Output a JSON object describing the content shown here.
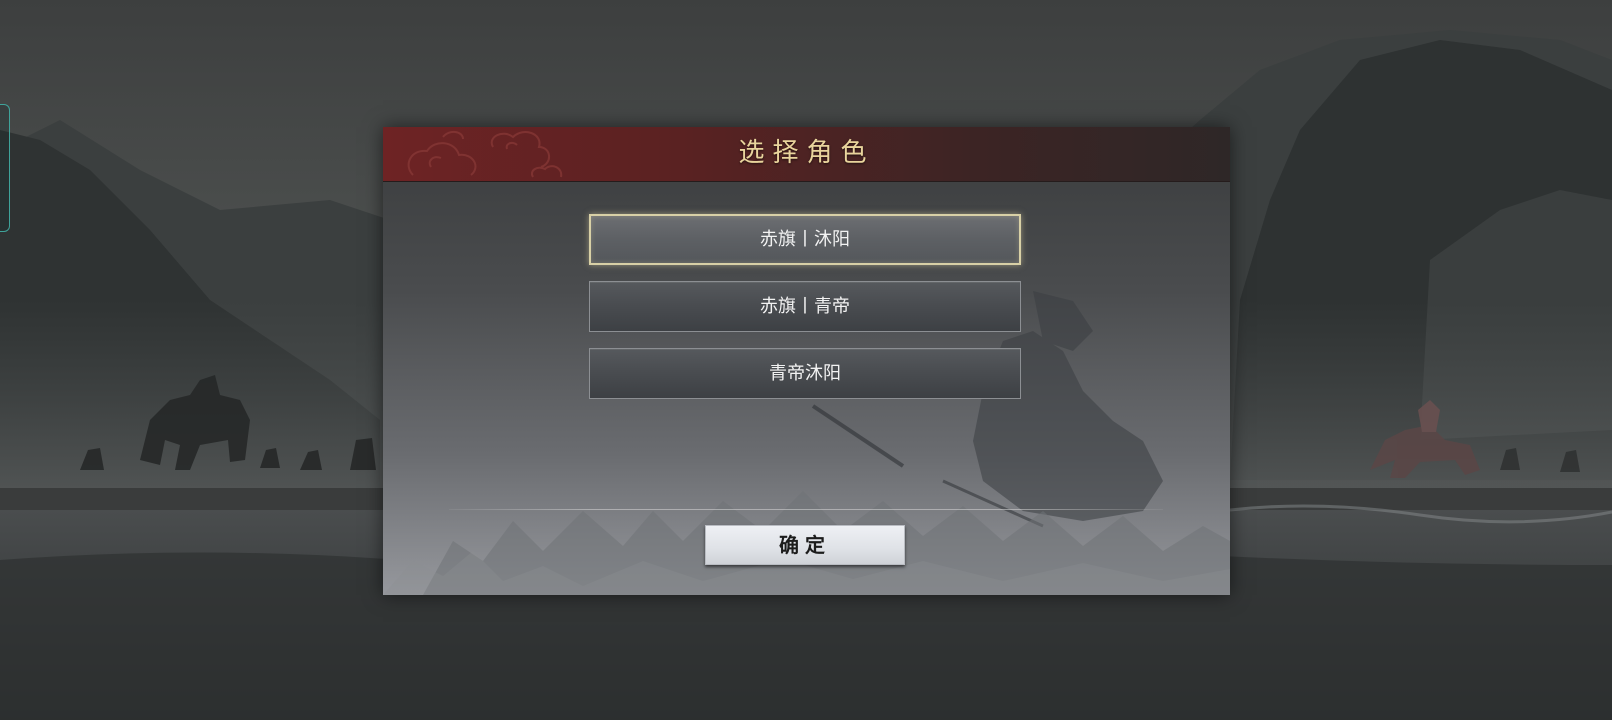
{
  "dialog": {
    "title": "选择角色",
    "options": [
      {
        "label": "赤旗丨沐阳",
        "selected": true
      },
      {
        "label": "赤旗丨青帝",
        "selected": false
      },
      {
        "label": "青帝沐阳",
        "selected": false
      }
    ],
    "confirm_label": "确定"
  },
  "colors": {
    "header_red": "#6e2324",
    "title_gold": "#e9d49c",
    "selected_border": "#d8d0a6",
    "side_tab_teal": "#3fa39a"
  }
}
